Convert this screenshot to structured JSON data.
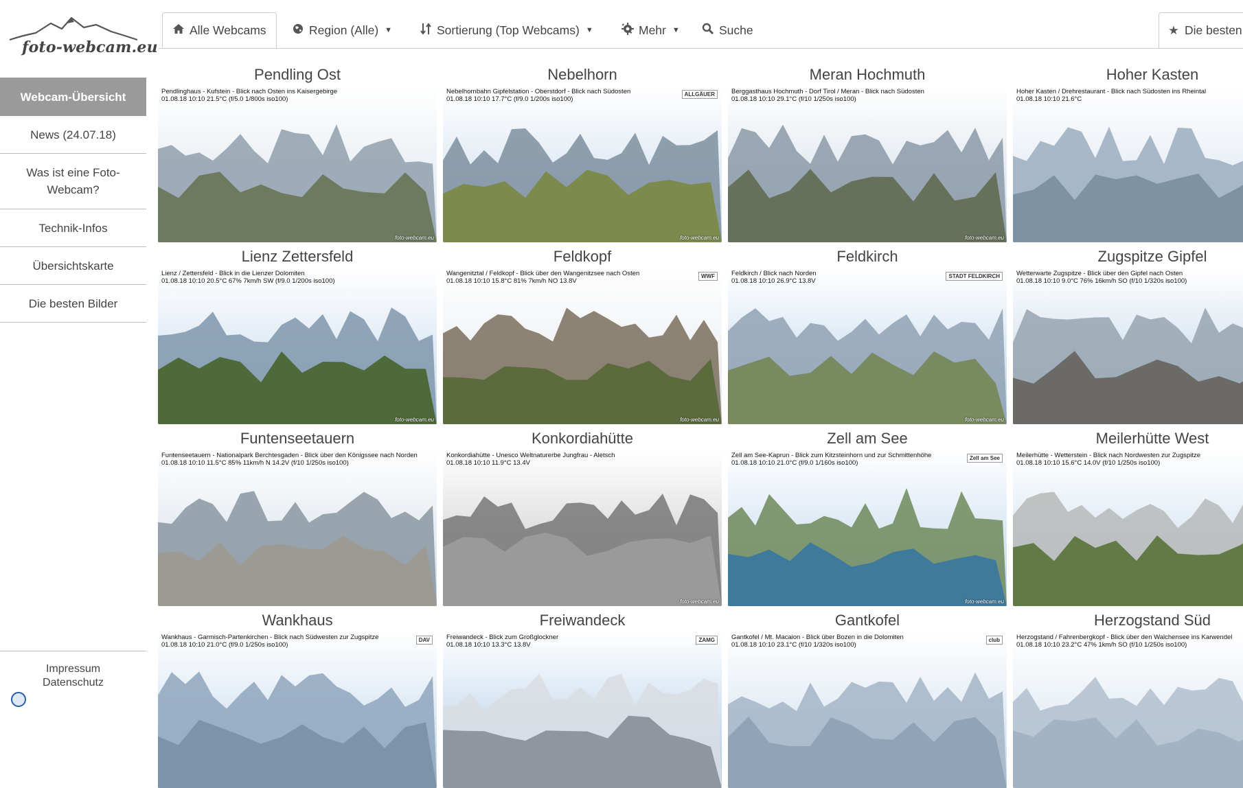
{
  "logo": {
    "text": "foto-webcam.eu"
  },
  "sidebar": {
    "items": [
      {
        "label": "Webcam-Übersicht",
        "active": true
      },
      {
        "label": "News (24.07.18)"
      },
      {
        "label": "Was ist eine Foto-Webcam?"
      },
      {
        "label": "Technik-Infos"
      },
      {
        "label": "Übersichtskarte"
      },
      {
        "label": "Die besten Bilder"
      }
    ],
    "footer": {
      "impressum": "Impressum",
      "datenschutz": "Datenschutz"
    }
  },
  "tabs": {
    "home": {
      "label": "Alle Webcams",
      "icon": "home-icon"
    },
    "region": {
      "label": "Region (Alle)",
      "icon": "globe-icon"
    },
    "sort": {
      "label": "Sortierung (Top Webcams)",
      "icon": "sort-icon"
    },
    "more": {
      "label": "Mehr",
      "icon": "gear-icon"
    },
    "search": {
      "label": "Suche",
      "icon": "search-icon"
    },
    "best": {
      "label": "Die besten",
      "icon": "star-icon"
    }
  },
  "webcams": [
    {
      "name": "Pendling Ost",
      "caption1": "Pendlinghaus - Kufstein - Blick nach Osten ins Kaisergebirge",
      "caption2": "01.08.18 10:10   21.5°C   (f/5.0  1/800s  iso100)",
      "sky": "#d9e3ec",
      "mtn": "#8fa0ad",
      "ground": "#6d7a5f",
      "watermark": "foto-webcam.eu"
    },
    {
      "name": "Nebelhorn",
      "caption1": "Nebelhornbahn Gipfelstation - Oberstdorf - Blick nach Südosten",
      "caption2": "01.08.18 10:10   17.7°C   (f/9.0  1/200s  iso100)",
      "sky": "#c8d8e8",
      "mtn": "#7d8fa0",
      "ground": "#7c8a4e",
      "watermark": "foto-webcam.eu"
    },
    {
      "name": "Meran Hochmuth",
      "caption1": "Berggasthaus Hochmuth - Dorf Tirol / Meran - Blick nach Südosten",
      "caption2": "01.08.18 10:10   29.1°C   (f/10  1/250s  iso100)",
      "sky": "#cdd9e4",
      "mtn": "#8b9aa8",
      "ground": "#66705a",
      "watermark": "foto-webcam.eu"
    },
    {
      "name": "Hoher Kasten",
      "caption1": "Hoher Kasten / Drehrestaurant - Blick nach Südosten ins Rheintal",
      "caption2": "01.08.18 10:10   21.6°C",
      "sky": "#d5e1ee",
      "mtn": "#9aaec0",
      "ground": "#7f92a4",
      "watermark": ""
    },
    {
      "name": "Lienz Zettersfeld",
      "caption1": "Lienz / Zettersfeld - Blick in die Lienzer Dolomiten",
      "caption2": "01.08.18 10:10   20.5°C   67%   7km/h SW   (f/9.0  1/200s  iso100)",
      "sky": "#c3d6ea",
      "mtn": "#7f96ad",
      "ground": "#4f6a3a",
      "watermark": "foto-webcam.eu"
    },
    {
      "name": "Feldkopf",
      "caption1": "Wangenitztal / Feldkopf - Blick über den Wangenitzsee nach Osten",
      "caption2": "01.08.18 10:10   15.8°C   81%   7km/h NO   13.8V",
      "sky": "#e2e7ec",
      "mtn": "#7a6f5d",
      "ground": "#5b6b3e",
      "watermark": "foto-webcam.eu"
    },
    {
      "name": "Feldkirch",
      "caption1": "Feldkirch / Blick nach Norden",
      "caption2": "01.08.18 10:10   26.9°C   13.8V",
      "sky": "#b9d0e8",
      "mtn": "#8fa2b4",
      "ground": "#7a8a60",
      "watermark": "foto-webcam.eu"
    },
    {
      "name": "Zugspitze Gipfel",
      "caption1": "Wetterwarte Zugspitze - Blick über den Gipfel nach Osten",
      "caption2": "01.08.18 10:10   9.0°C   76%   16km/h SO   (f/10  1/320s  iso100)",
      "sky": "#b8cde2",
      "mtn": "#96a4b0",
      "ground": "#6c6a66",
      "watermark": ""
    },
    {
      "name": "Funtenseetauern",
      "caption1": "Funtenseetauern - Nationalpark Berchtesgaden - Blick über den Königssee nach Norden",
      "caption2": "01.08.18 10:10   11.5°C   85%   11km/h N   14.2V   (f/10  1/250s  iso100)",
      "sky": "#cfdae5",
      "mtn": "#8a96a1",
      "ground": "#9c9a92",
      "watermark": ""
    },
    {
      "name": "Konkordiahütte",
      "caption1": "Konkordiahütte - Unesco Weltnaturerbe Jungfrau - Aletsch",
      "caption2": "01.08.18 10:10   11.9°C   13.4V",
      "sky": "#c2c2c2",
      "mtn": "#777777",
      "ground": "#9a9a9a",
      "watermark": "foto-webcam.eu"
    },
    {
      "name": "Zell am See",
      "caption1": "Zell am See-Kaprun - Blick zum Kitzsteinhorn und zur Schmittenhöhe",
      "caption2": "01.08.18 10:10   21.0°C   (f/9.0  1/160s  iso100)",
      "sky": "#bcd3ea",
      "mtn": "#6d8a5a",
      "ground": "#3f7a9c",
      "watermark": "foto-webcam.eu"
    },
    {
      "name": "Meilerhütte West",
      "caption1": "Meilerhütte - Wetterstein - Blick nach Nordwesten zur Zugspitze",
      "caption2": "01.08.18 10:10   15.6°C   14.0V   (f/10  1/250s  iso100)",
      "sky": "#c5d8ea",
      "mtn": "#b7b9b8",
      "ground": "#627a46",
      "watermark": ""
    },
    {
      "name": "Wankhaus",
      "caption1": "Wankhaus - Garmisch-Partenkirchen - Blick nach Südwesten zur Zugspitze",
      "caption2": "01.08.18 10:10   21.0°C   (f/9.0  1/250s  iso100)",
      "sky": "#bed3e8",
      "mtn": "#8ea6bd",
      "ground": "#7c93a9",
      "watermark": ""
    },
    {
      "name": "Freiwandeck",
      "caption1": "Freiwandeck - Blick zum Großglockner",
      "caption2": "01.08.18 10:10   13.3°C   13.8V",
      "sky": "#aac7e4",
      "mtn": "#d9dde2",
      "ground": "#8f96a0",
      "watermark": ""
    },
    {
      "name": "Gantkofel",
      "caption1": "Gantkofel / Mt. Macaion - Blick über Bozen in die Dolomiten",
      "caption2": "01.08.18 10:10   23.1°C   (f/10  1/320s  iso100)",
      "sky": "#cbdaea",
      "mtn": "#a3b5c7",
      "ground": "#91a4b7",
      "watermark": ""
    },
    {
      "name": "Herzogstand Süd",
      "caption1": "Herzogstand / Fahrenbergkopf - Blick über den Walchensee ins Karwendel",
      "caption2": "01.08.18 10:10   23.2°C   47%   1km/h SO   (f/10  1/250s  iso100)",
      "sky": "#d3e0ec",
      "mtn": "#b0c0cf",
      "ground": "#a2b3c3",
      "watermark": ""
    }
  ],
  "cam_badges": {
    "1": "ALLGÄUER",
    "5": "WWF",
    "6": "STADT FELDKIRCH",
    "10": "Zell am See",
    "12": "DAV",
    "13": "ZAMG",
    "14": "club"
  }
}
